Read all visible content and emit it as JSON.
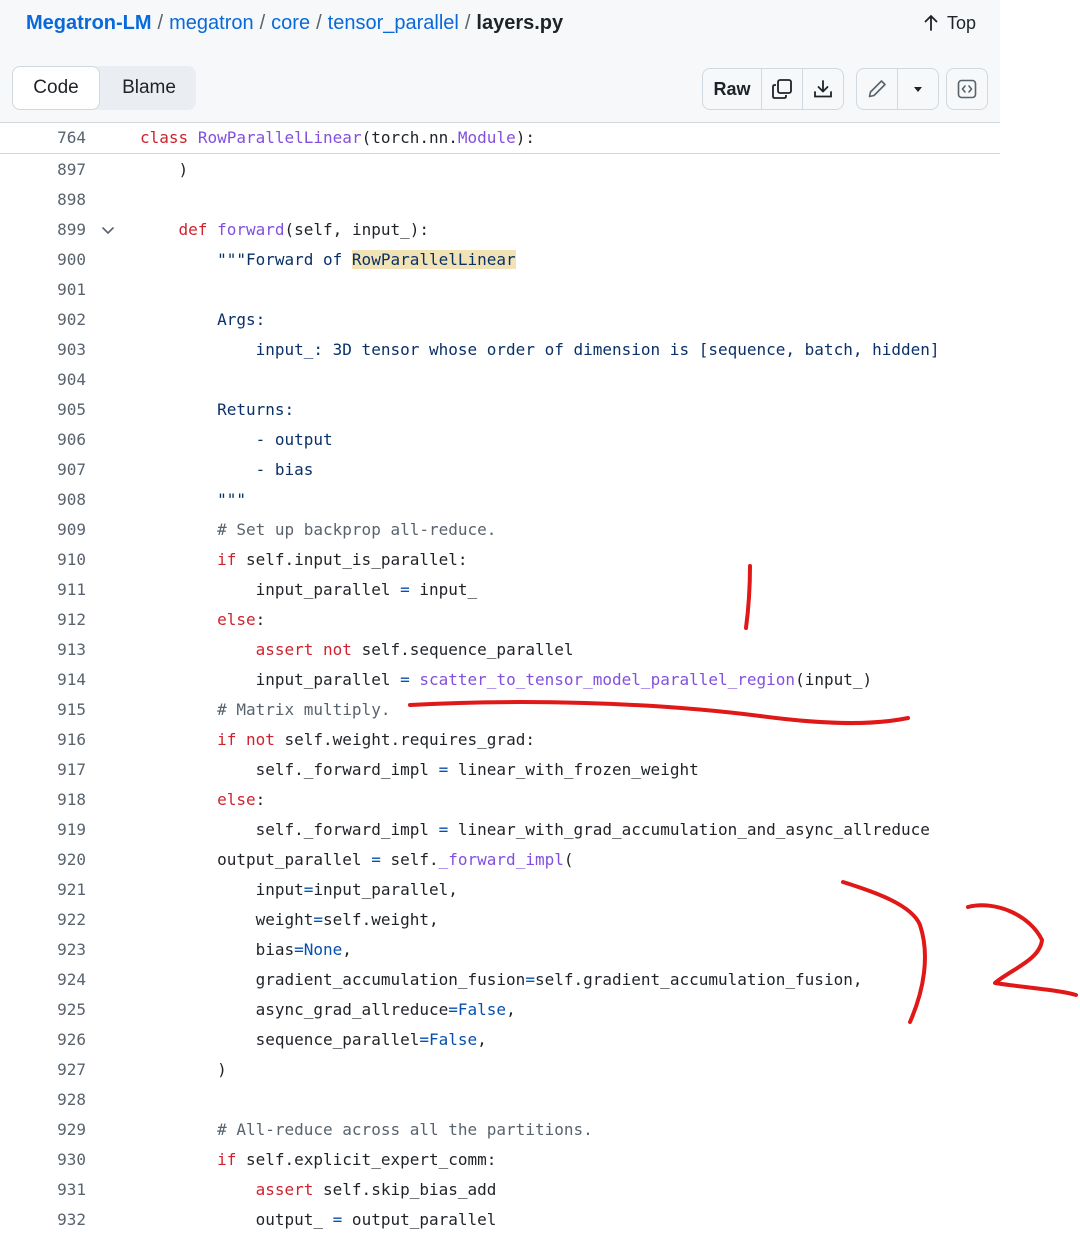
{
  "breadcrumb": {
    "repo": "Megatron-LM",
    "parts": [
      "megatron",
      "core",
      "tensor_parallel"
    ],
    "file": "layers.py",
    "top_label": "Top"
  },
  "toolbar": {
    "code_tab": "Code",
    "blame_tab": "Blame",
    "raw_label": "Raw",
    "icons": [
      "copy-icon",
      "download-icon",
      "pencil-icon",
      "triangle-down-icon",
      "code-square-icon"
    ]
  },
  "sticky": {
    "line_number": "764",
    "code": "class RowParallelLinear(torch.nn.Module):"
  },
  "code_lines": [
    {
      "n": "897",
      "text": "    )"
    },
    {
      "n": "898",
      "text": ""
    },
    {
      "n": "899",
      "text": "    def forward(self, input_):"
    },
    {
      "n": "900",
      "text": "        \"\"\"Forward of RowParallelLinear"
    },
    {
      "n": "901",
      "text": ""
    },
    {
      "n": "902",
      "text": "        Args:"
    },
    {
      "n": "903",
      "text": "            input_: 3D tensor whose order of dimension is [sequence, batch, hidden]"
    },
    {
      "n": "904",
      "text": ""
    },
    {
      "n": "905",
      "text": "        Returns:"
    },
    {
      "n": "906",
      "text": "            - output"
    },
    {
      "n": "907",
      "text": "            - bias"
    },
    {
      "n": "908",
      "text": "        \"\"\""
    },
    {
      "n": "909",
      "text": "        # Set up backprop all-reduce."
    },
    {
      "n": "910",
      "text": "        if self.input_is_parallel:"
    },
    {
      "n": "911",
      "text": "            input_parallel = input_"
    },
    {
      "n": "912",
      "text": "        else:"
    },
    {
      "n": "913",
      "text": "            assert not self.sequence_parallel"
    },
    {
      "n": "914",
      "text": "            input_parallel = scatter_to_tensor_model_parallel_region(input_)"
    },
    {
      "n": "915",
      "text": "        # Matrix multiply."
    },
    {
      "n": "916",
      "text": "        if not self.weight.requires_grad:"
    },
    {
      "n": "917",
      "text": "            self._forward_impl = linear_with_frozen_weight"
    },
    {
      "n": "918",
      "text": "        else:"
    },
    {
      "n": "919",
      "text": "            self._forward_impl = linear_with_grad_accumulation_and_async_allreduce"
    },
    {
      "n": "920",
      "text": "        output_parallel = self._forward_impl("
    },
    {
      "n": "921",
      "text": "            input=input_parallel,"
    },
    {
      "n": "922",
      "text": "            weight=self.weight,"
    },
    {
      "n": "923",
      "text": "            bias=None,"
    },
    {
      "n": "924",
      "text": "            gradient_accumulation_fusion=self.gradient_accumulation_fusion,"
    },
    {
      "n": "925",
      "text": "            async_grad_allreduce=False,"
    },
    {
      "n": "926",
      "text": "            sequence_parallel=False,"
    },
    {
      "n": "927",
      "text": "        )"
    },
    {
      "n": "928",
      "text": ""
    },
    {
      "n": "929",
      "text": "        # All-reduce across all the partitions."
    },
    {
      "n": "930",
      "text": "        if self.explicit_expert_comm:"
    },
    {
      "n": "931",
      "text": "            assert self.skip_bias_add"
    },
    {
      "n": "932",
      "text": "            output_ = output_parallel"
    }
  ],
  "highlighted_symbol": "RowParallelLinear",
  "colors": {
    "link": "#0969da",
    "keyword": "#cf222e",
    "function": "#8250df",
    "string": "#0a3069",
    "comment": "#59636e",
    "constant": "#0550ae",
    "highlight": "#f2e3b6",
    "annotation": "#e01818"
  }
}
